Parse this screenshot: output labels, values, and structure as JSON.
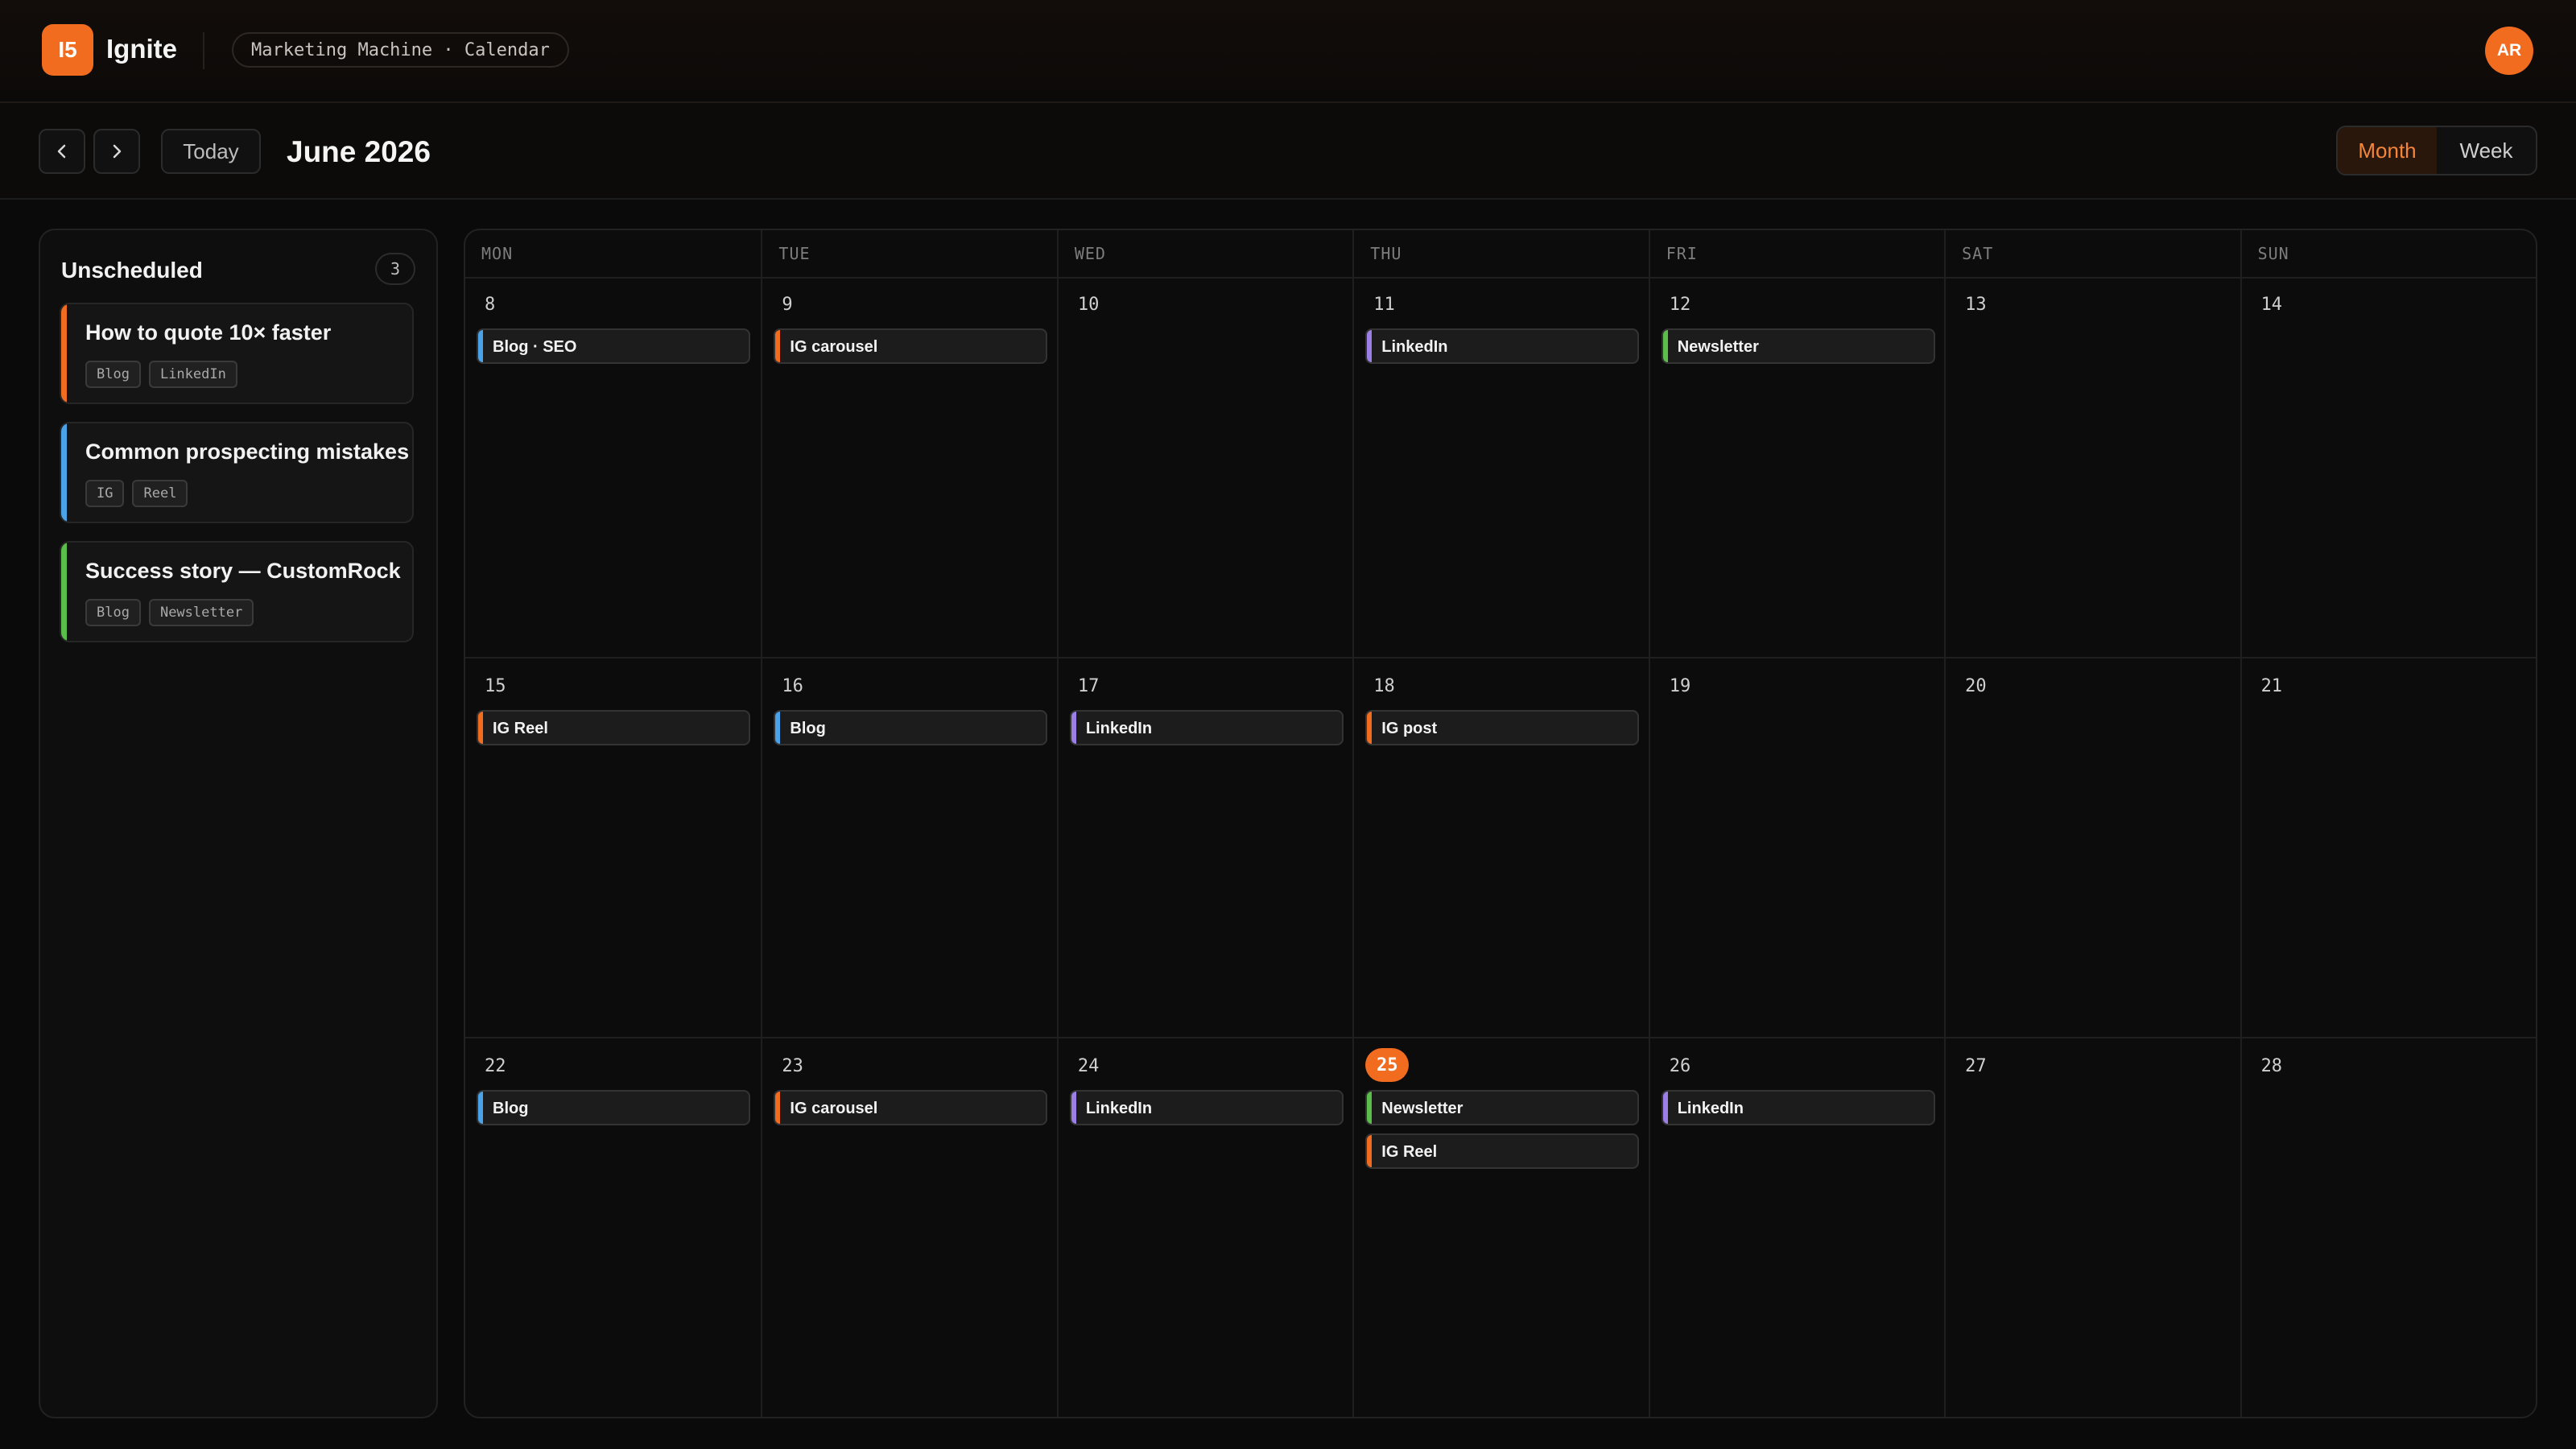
{
  "app": {
    "logo_text": "I5",
    "brand": "Ignite",
    "context": "Marketing Machine · Calendar",
    "avatar_initials": "AR",
    "accent_color": "#f26c1f"
  },
  "toolbar": {
    "prev_icon": "chevron-left-icon",
    "next_icon": "chevron-right-icon",
    "today_label": "Today",
    "month_title": "June 2026",
    "view_options": [
      "Month",
      "Week"
    ],
    "active_view": "Month"
  },
  "sidebar": {
    "title": "Unscheduled",
    "count": "3",
    "cards": [
      {
        "title": "How to quote 10× faster",
        "tags": [
          "Blog",
          "LinkedIn"
        ],
        "color": "#f26c1f"
      },
      {
        "title": "Common prospecting mistakes",
        "tags": [
          "IG",
          "Reel"
        ],
        "color": "#4aa3e8"
      },
      {
        "title": "Success story — CustomRock",
        "tags": [
          "Blog",
          "Newsletter"
        ],
        "color": "#5bbd4a"
      }
    ]
  },
  "colors": {
    "blog": "#4aa3e8",
    "ig": "#f26c1f",
    "linkedin": "#9b7fe6",
    "newsletter": "#5bbd4a"
  },
  "calendar": {
    "weekdays": [
      "MON",
      "TUE",
      "WED",
      "THU",
      "FRI",
      "SAT",
      "SUN"
    ],
    "today": "25",
    "weeks": [
      [
        {
          "day": "8",
          "events": [
            {
              "label": "Blog · SEO",
              "kind": "blog"
            }
          ]
        },
        {
          "day": "9",
          "events": [
            {
              "label": "IG carousel",
              "kind": "ig"
            }
          ]
        },
        {
          "day": "10",
          "events": []
        },
        {
          "day": "11",
          "events": [
            {
              "label": "LinkedIn",
              "kind": "linkedin"
            }
          ]
        },
        {
          "day": "12",
          "events": [
            {
              "label": "Newsletter",
              "kind": "newsletter"
            }
          ]
        },
        {
          "day": "13",
          "events": []
        },
        {
          "day": "14",
          "events": []
        }
      ],
      [
        {
          "day": "15",
          "events": [
            {
              "label": "IG Reel",
              "kind": "ig"
            }
          ]
        },
        {
          "day": "16",
          "events": [
            {
              "label": "Blog",
              "kind": "blog"
            }
          ]
        },
        {
          "day": "17",
          "events": [
            {
              "label": "LinkedIn",
              "kind": "linkedin"
            }
          ]
        },
        {
          "day": "18",
          "events": [
            {
              "label": "IG post",
              "kind": "ig"
            }
          ]
        },
        {
          "day": "19",
          "events": []
        },
        {
          "day": "20",
          "events": []
        },
        {
          "day": "21",
          "events": []
        }
      ],
      [
        {
          "day": "22",
          "events": [
            {
              "label": "Blog",
              "kind": "blog"
            }
          ]
        },
        {
          "day": "23",
          "events": [
            {
              "label": "IG carousel",
              "kind": "ig"
            }
          ]
        },
        {
          "day": "24",
          "events": [
            {
              "label": "LinkedIn",
              "kind": "linkedin"
            }
          ]
        },
        {
          "day": "25",
          "events": [
            {
              "label": "Newsletter",
              "kind": "newsletter"
            },
            {
              "label": "IG Reel",
              "kind": "ig"
            }
          ]
        },
        {
          "day": "26",
          "events": [
            {
              "label": "LinkedIn",
              "kind": "linkedin"
            }
          ]
        },
        {
          "day": "27",
          "events": []
        },
        {
          "day": "28",
          "events": []
        }
      ]
    ]
  }
}
